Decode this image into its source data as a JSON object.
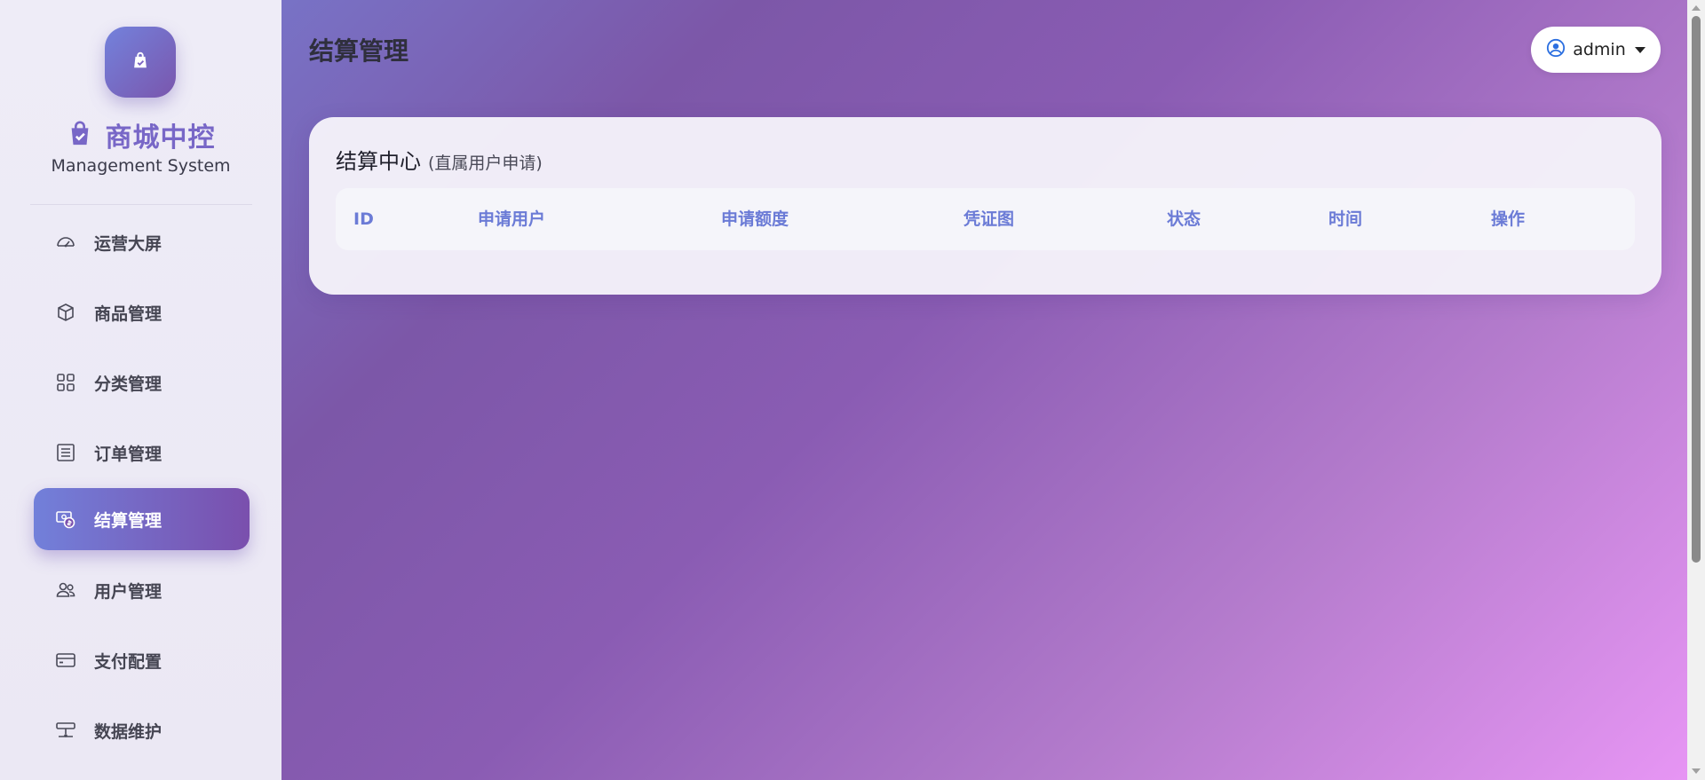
{
  "sidebar": {
    "brand_title": "商城中控",
    "brand_subtitle": "Management System",
    "items": [
      {
        "label": "运营大屏",
        "icon": "speedometer-icon",
        "active": false
      },
      {
        "label": "商品管理",
        "icon": "box-icon",
        "active": false
      },
      {
        "label": "分类管理",
        "icon": "grid-icon",
        "active": false
      },
      {
        "label": "订单管理",
        "icon": "list-icon",
        "active": false
      },
      {
        "label": "结算管理",
        "icon": "cash-coin-icon",
        "active": true
      },
      {
        "label": "用户管理",
        "icon": "people-icon",
        "active": false
      },
      {
        "label": "支付配置",
        "icon": "credit-card-icon",
        "active": false
      },
      {
        "label": "数据维护",
        "icon": "sliders-icon",
        "active": false
      }
    ]
  },
  "header": {
    "title": "结算管理",
    "user_name": "admin"
  },
  "card": {
    "title": "结算中心",
    "subtitle": "(直属用户申请)",
    "columns": [
      "ID",
      "申请用户",
      "申请额度",
      "凭证图",
      "状态",
      "时间",
      "操作"
    ]
  },
  "colors": {
    "accent": "#7867c7",
    "table_header_text": "#6b7bd6",
    "active_nav_start": "#7280da",
    "active_nav_end": "#7a4fad"
  }
}
